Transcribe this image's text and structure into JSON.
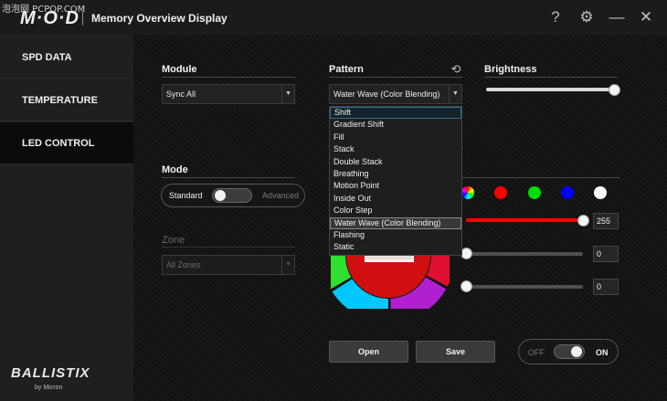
{
  "watermark": "泡泡网 PCPOP.COM",
  "app": {
    "logo": "M·O·D",
    "title": "Memory Overview Display"
  },
  "titlebar": {
    "help_icon": "?",
    "settings_icon": "⚙",
    "minimize_icon": "—",
    "close_icon": "✕"
  },
  "sidebar": {
    "items": [
      {
        "label": "SPD DATA",
        "active": false
      },
      {
        "label": "TEMPERATURE",
        "active": false
      },
      {
        "label": "LED CONTROL",
        "active": true
      }
    ],
    "brand": "BALLISTIX",
    "brand_sub": "by Micron"
  },
  "module": {
    "label": "Module",
    "value": "Sync All"
  },
  "pattern": {
    "label": "Pattern",
    "value": "Water Wave (Color Blending)",
    "reset_icon": "history-icon",
    "options": [
      "Shift",
      "Gradient Shift",
      "Fill",
      "Stack",
      "Double Stack",
      "Breathing",
      "Motion Point",
      "Inside Out",
      "Color Step",
      "Water Wave (Color Blending)",
      "Flashing",
      "Static"
    ],
    "hovered": "Shift",
    "selected": "Water Wave (Color Blending)"
  },
  "brightness": {
    "label": "Brightness",
    "level": 1.0
  },
  "mode": {
    "label": "Mode",
    "left": "Standard",
    "right": "Advanced",
    "advanced": false
  },
  "zone": {
    "label": "Zone",
    "value": "All Zones"
  },
  "colors": {
    "swatches": [
      "#ff0000",
      "#00dd00",
      "#0000ff",
      "#ffffff"
    ],
    "sliders": [
      {
        "value": "255",
        "color": "#ff0000",
        "level": 1.0
      },
      {
        "value": "0",
        "color": "#ffffff",
        "level": 0.0
      },
      {
        "value": "0",
        "color": "#ffffff",
        "level": 0.0
      }
    ]
  },
  "buttons": {
    "open": "Open",
    "save": "Save"
  },
  "power": {
    "off": "OFF",
    "on": "ON",
    "state": "on"
  }
}
